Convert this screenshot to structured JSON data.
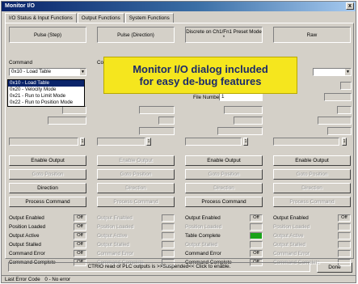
{
  "window": {
    "title": "Monitor I/O",
    "close_glyph": "x"
  },
  "tabs": [
    {
      "label": "I/O Status & Input Functions"
    },
    {
      "label": "Output Functions"
    },
    {
      "label": "System Functions"
    }
  ],
  "columns": [
    {
      "header": "Pulse (Step)",
      "command_label": "Command",
      "command_value": "0x10 - Load Table",
      "buttons": [
        "Enable Output",
        "Goto Position",
        "Direction",
        "Process Command"
      ],
      "statuses": [
        {
          "name": "Output Enabled",
          "value": "Off"
        },
        {
          "name": "Position Loaded",
          "value": "Off"
        },
        {
          "name": "Output Active",
          "value": "Off"
        },
        {
          "name": "Output Stalled",
          "value": "Off"
        },
        {
          "name": "Command Error",
          "value": "Off"
        },
        {
          "name": "Command Complete",
          "value": "Off"
        }
      ]
    },
    {
      "header": "Pulse (Direction)",
      "command_label": "Comm",
      "buttons": [
        "Enable Output",
        "Goto Position",
        "Direction",
        "Process Command"
      ],
      "statuses": [
        {
          "name": "Output Enabled",
          "value": ""
        },
        {
          "name": "Position Loaded",
          "value": ""
        },
        {
          "name": "Output Active",
          "value": ""
        },
        {
          "name": "Output Stalled",
          "value": ""
        },
        {
          "name": "Command Error",
          "value": ""
        },
        {
          "name": "Command Complete",
          "value": ""
        }
      ]
    },
    {
      "header": "Discrete on Ch1/Fn1 Preset Mode *",
      "file_number_label": "File Number",
      "file_number_value": "1",
      "buttons": [
        "Enable Output",
        "Goto Position",
        "Direction",
        "Process Command"
      ],
      "statuses": [
        {
          "name": "Output Enabled",
          "value": "Off"
        },
        {
          "name": "Position Loaded",
          "value": ""
        },
        {
          "name": "Table Complete",
          "value": "On"
        },
        {
          "name": "Output Stalled",
          "value": ""
        },
        {
          "name": "Command Error",
          "value": "Off"
        },
        {
          "name": "Command Complete",
          "value": "Off"
        }
      ]
    },
    {
      "header": "Raw",
      "buttons": [
        "Enable Output",
        "Goto Position",
        "Direction",
        "Process Command"
      ],
      "statuses": [
        {
          "name": "Output Enabled",
          "value": "Off"
        },
        {
          "name": "Position Loaded",
          "value": ""
        },
        {
          "name": "Output Active",
          "value": ""
        },
        {
          "name": "Output Stalled",
          "value": ""
        },
        {
          "name": "Command Error",
          "value": ""
        },
        {
          "name": "Command Complete",
          "value": ""
        }
      ]
    }
  ],
  "dropdown_options": [
    "0x10 - Load Table",
    "0x20 - Velocity Mode",
    "0x21 - Run to Limit Mode",
    "0x22 - Run to Position Mode"
  ],
  "spin_value": "1",
  "callout": {
    "line1": "Monitor I/O dialog included",
    "line2": "for easy de-bug features"
  },
  "bottom": {
    "message": "CTRIO read of PLC outputs is >>Suspended<< Click to enable.",
    "done_label": "Done",
    "status_label": "Last Error Code",
    "status_value": "0 - No error"
  },
  "colors": {
    "title_bar": "#0a246a",
    "callout_bg": "#f5e61e",
    "callout_text": "#1b2a6b",
    "status_on": "#1aa31a"
  }
}
